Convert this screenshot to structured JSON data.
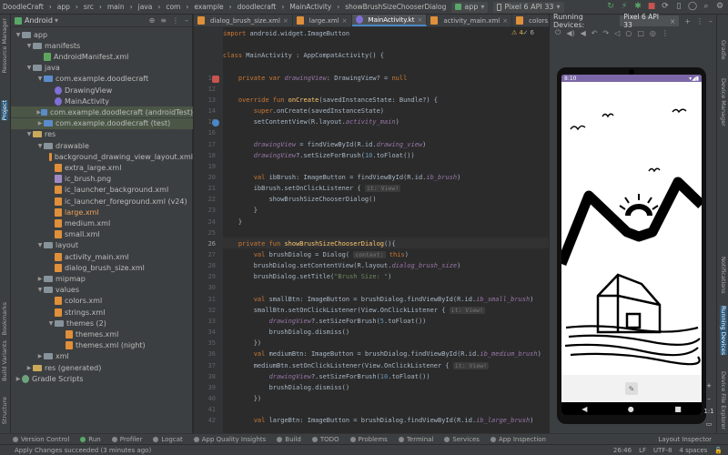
{
  "titlebar": {
    "breadcrumbs": [
      "DoodleCraft",
      "app",
      "src",
      "main",
      "java",
      "com",
      "example",
      "doodlecraft"
    ],
    "file_crumb": "MainActivity",
    "method_crumb": "showBrushSizeChooserDialog",
    "run_config": "app",
    "device": "Pixel 6 API 33"
  },
  "project": {
    "view_label": "Android",
    "tree": [
      {
        "label": "app",
        "depth": 0,
        "type": "folder",
        "expanded": true
      },
      {
        "label": "manifests",
        "depth": 1,
        "type": "folder",
        "expanded": true
      },
      {
        "label": "AndroidManifest.xml",
        "depth": 2,
        "type": "manifest"
      },
      {
        "label": "java",
        "depth": 1,
        "type": "folder",
        "expanded": true
      },
      {
        "label": "com.example.doodlecraft",
        "depth": 2,
        "type": "pkg",
        "expanded": true
      },
      {
        "label": "DrawingView",
        "depth": 3,
        "type": "kt"
      },
      {
        "label": "MainActivity",
        "depth": 3,
        "type": "kt"
      },
      {
        "label": "com.example.doodlecraft (androidTest)",
        "depth": 2,
        "type": "pkg",
        "highlight": true
      },
      {
        "label": "com.example.doodlecraft (test)",
        "depth": 2,
        "type": "pkg",
        "highlight": true
      },
      {
        "label": "res",
        "depth": 1,
        "type": "res",
        "expanded": true
      },
      {
        "label": "drawable",
        "depth": 2,
        "type": "folder",
        "expanded": true
      },
      {
        "label": "background_drawing_view_layout.xml",
        "depth": 3,
        "type": "xml"
      },
      {
        "label": "extra_large.xml",
        "depth": 3,
        "type": "xml"
      },
      {
        "label": "ic_brush.png",
        "depth": 3,
        "type": "png"
      },
      {
        "label": "ic_launcher_background.xml",
        "depth": 3,
        "type": "xml"
      },
      {
        "label": "ic_launcher_foreground.xml (v24)",
        "depth": 3,
        "type": "xml"
      },
      {
        "label": "large.xml",
        "depth": 3,
        "type": "xml",
        "modified": true
      },
      {
        "label": "medium.xml",
        "depth": 3,
        "type": "xml"
      },
      {
        "label": "small.xml",
        "depth": 3,
        "type": "xml"
      },
      {
        "label": "layout",
        "depth": 2,
        "type": "folder",
        "expanded": true
      },
      {
        "label": "activity_main.xml",
        "depth": 3,
        "type": "xml"
      },
      {
        "label": "dialog_brush_size.xml",
        "depth": 3,
        "type": "xml"
      },
      {
        "label": "mipmap",
        "depth": 2,
        "type": "folder"
      },
      {
        "label": "values",
        "depth": 2,
        "type": "folder",
        "expanded": true
      },
      {
        "label": "colors.xml",
        "depth": 3,
        "type": "xml"
      },
      {
        "label": "strings.xml",
        "depth": 3,
        "type": "xml"
      },
      {
        "label": "themes (2)",
        "depth": 3,
        "type": "folder",
        "expanded": true
      },
      {
        "label": "themes.xml",
        "depth": 4,
        "type": "xml"
      },
      {
        "label": "themes.xml (night)",
        "depth": 4,
        "type": "xml"
      },
      {
        "label": "xml",
        "depth": 2,
        "type": "folder"
      },
      {
        "label": "res (generated)",
        "depth": 1,
        "type": "res"
      },
      {
        "label": "Gradle Scripts",
        "depth": 0,
        "type": "gradle"
      }
    ]
  },
  "editor_tabs": [
    {
      "label": "dialog_brush_size.xml",
      "active": false
    },
    {
      "label": "large.xml",
      "active": false
    },
    {
      "label": "MainActivity.kt",
      "active": true
    },
    {
      "label": "activity_main.xml",
      "active": false
    },
    {
      "label": "colors.xml",
      "active": false
    }
  ],
  "editor": {
    "warnings": "4",
    "errors": "6",
    "current_line": "26",
    "lines": [
      {
        "n": "",
        "html": "<span class='kw'>import</span> android.widget.ImageButton"
      },
      {
        "n": "",
        "html": ""
      },
      {
        "n": "",
        "html": "<span class='kw'>class</span> MainActivity : AppCompatActivity() {"
      },
      {
        "n": "",
        "html": ""
      },
      {
        "n": "11",
        "html": "    <span class='kw'>private var</span> <span class='it'>drawingView</span>: DrawingView? = <span class='kw'>null</span>"
      },
      {
        "n": "12",
        "html": ""
      },
      {
        "n": "13",
        "html": "    <span class='kw'>override fun</span> <span class='fn'>onCreate</span>(savedInstanceState: Bundle?) {"
      },
      {
        "n": "14",
        "html": "        <span class='kw'>super</span>.onCreate(savedInstanceState)"
      },
      {
        "n": "15",
        "html": "        setContentView(R.layout.<span class='it'>activity_main</span>)"
      },
      {
        "n": "16",
        "html": ""
      },
      {
        "n": "17",
        "html": "        <span class='it'>drawingView</span> = findViewById(R.id.<span class='it'>drawing_view</span>)"
      },
      {
        "n": "18",
        "html": "        <span class='it'>drawingView</span>?.setSizeForBrush(<span class='num'>10</span>.toFloat())"
      },
      {
        "n": "19",
        "html": ""
      },
      {
        "n": "20",
        "html": "        <span class='kw'>val</span> ibBrush: ImageButton = findViewById(R.id.<span class='it'>ib_brush</span>)"
      },
      {
        "n": "21",
        "html": "        ibBrush.setOnClickListener { <span class='hint'>it: View!</span>"
      },
      {
        "n": "22",
        "html": "            showBrushSizeChooserDialog()"
      },
      {
        "n": "23",
        "html": "        }"
      },
      {
        "n": "24",
        "html": "    }"
      },
      {
        "n": "25",
        "html": ""
      },
      {
        "n": "26",
        "html": "    <span class='kw'>private fun</span> <span class='fn'>showBrushSizeChooserDialog</span>(){"
      },
      {
        "n": "27",
        "html": "        <span class='kw'>val</span> brushDialog = Dialog( <span class='hint'>context:</span> <span class='kw'>this</span>)"
      },
      {
        "n": "28",
        "html": "        brushDialog.setContentView(R.layout.<span class='it'>dialog_brush_size</span>)"
      },
      {
        "n": "29",
        "html": "        brushDialog.setTitle(<span class='str'>\"Brush Size: \"</span>)"
      },
      {
        "n": "30",
        "html": ""
      },
      {
        "n": "31",
        "html": "        <span class='kw'>val</span> smallBtn: ImageButton = brushDialog.findViewById(R.id.<span class='it'>ib_small_brush</span>)"
      },
      {
        "n": "32",
        "html": "        smallBtn.setOnClickListener(View.OnClickListener { <span class='hint'>it: View!</span>"
      },
      {
        "n": "33",
        "html": "            <span class='it'>drawingView</span>?.setSizeForBrush(<span class='num'>5</span>.toFloat())"
      },
      {
        "n": "34",
        "html": "            brushDialog.dismiss()"
      },
      {
        "n": "35",
        "html": "        })"
      },
      {
        "n": "36",
        "html": "        <span class='kw'>val</span> mediumBtn: ImageButton = brushDialog.findViewById(R.id.<span class='it'>ib_medium_brush</span>)"
      },
      {
        "n": "37",
        "html": "        mediumBtn.setOnClickListener(View.OnClickListener { <span class='hint'>it: View!</span>"
      },
      {
        "n": "38",
        "html": "            <span class='it'>drawingView</span>?.setSizeForBrush(<span class='num'>10</span>.toFloat())"
      },
      {
        "n": "39",
        "html": "            brushDialog.dismiss()"
      },
      {
        "n": "40",
        "html": "        })"
      },
      {
        "n": "41",
        "html": ""
      },
      {
        "n": "42",
        "html": "        <span class='kw'>val</span> largeBtn: ImageButton = brushDialog.findViewById(R.id.<span class='it'>ib_large_brush</span>)"
      }
    ]
  },
  "devices": {
    "title": "Running Devices:",
    "device_tab": "Pixel 6 API 33",
    "phone_time": "8:10",
    "zoom_label": "1:1"
  },
  "left_tabs": [
    "Resource Manager",
    "Project",
    "Bookmarks",
    "Build Variants",
    "Structure"
  ],
  "right_tabs": [
    "Gradle",
    "Device Manager",
    "Notifications",
    "Running Devices",
    "Device File Explorer"
  ],
  "bottom_tools": [
    {
      "label": "Version Control",
      "color": "#888888"
    },
    {
      "label": "Run",
      "color": "#59a869"
    },
    {
      "label": "Profiler",
      "color": "#888888"
    },
    {
      "label": "Logcat",
      "color": "#888888"
    },
    {
      "label": "App Quality Insights",
      "color": "#888888"
    },
    {
      "label": "Build",
      "color": "#888888"
    },
    {
      "label": "TODO",
      "color": "#888888"
    },
    {
      "label": "Problems",
      "color": "#888888"
    },
    {
      "label": "Terminal",
      "color": "#888888"
    },
    {
      "label": "Services",
      "color": "#888888"
    },
    {
      "label": "App Inspection",
      "color": "#888888"
    }
  ],
  "layout_inspector": "Layout Inspector",
  "status": {
    "message": "Apply Changes succeeded (3 minutes ago)",
    "position": "26:46",
    "line_sep": "LF",
    "encoding": "UTF-8",
    "indent": "4 spaces"
  }
}
